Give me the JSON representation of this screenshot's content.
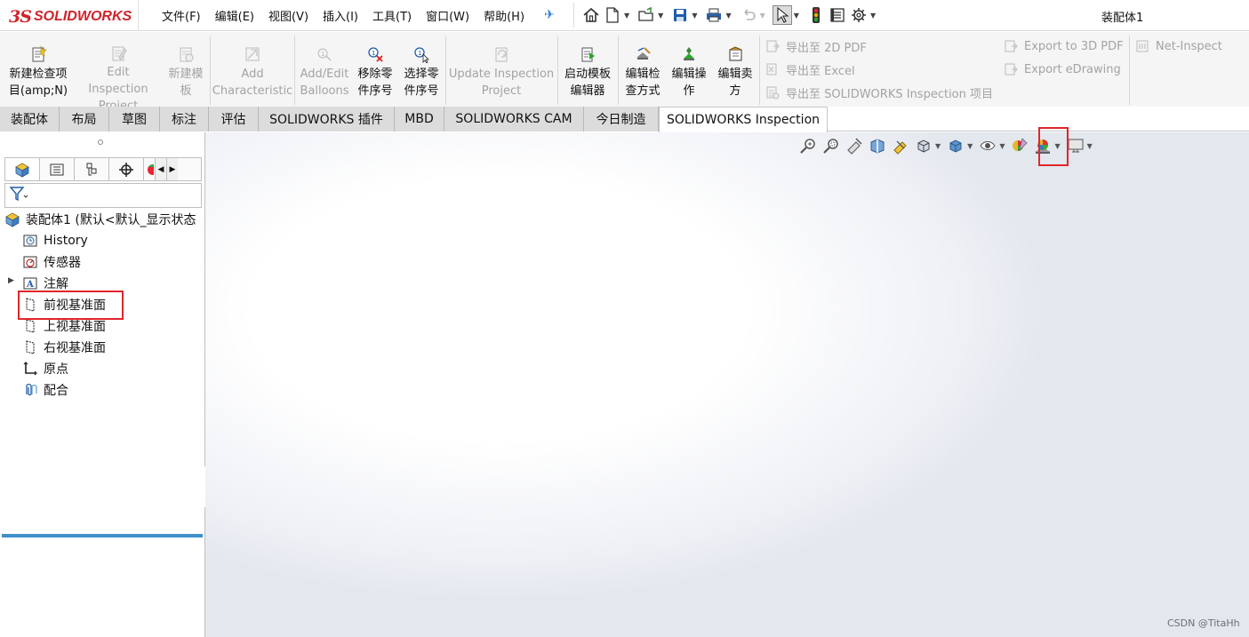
{
  "app": {
    "logo_prefix": "3S",
    "logo_text": "SOLIDWORKS",
    "document_title": "装配体1"
  },
  "menu": [
    "文件(F)",
    "编辑(E)",
    "视图(V)",
    "插入(I)",
    "工具(T)",
    "窗口(W)",
    "帮助(H)"
  ],
  "toolbar": {
    "new_inspection_project": [
      "新建检查项",
      "目(amp;N)"
    ],
    "edit_inspection_project": [
      "Edit Inspection",
      "Project"
    ],
    "new_template": [
      "新建模",
      "板"
    ],
    "add_characteristic": [
      "Add",
      "Characteristic"
    ],
    "add_edit_balloons": [
      "Add/Edit",
      "Balloons"
    ],
    "remove_part_number": [
      "移除零",
      "件序号"
    ],
    "select_part_number": [
      "选择零",
      "件序号"
    ],
    "update_inspection_project": [
      "Update Inspection",
      "Project"
    ],
    "launch_template_editor": [
      "启动模板",
      "编辑器"
    ],
    "edit_inspection_method": [
      "编辑检",
      "查方式"
    ],
    "edit_operation": [
      "编辑操",
      "作"
    ],
    "edit_vendor": [
      "编辑卖",
      "方"
    ],
    "export_2d_pdf": "导出至 2D PDF",
    "export_excel": "导出至 Excel",
    "export_sw_inspection": "导出至 SOLIDWORKS Inspection 项目",
    "export_3d_pdf": "Export to 3D PDF",
    "export_edrawing": "Export eDrawing",
    "net_inspect": "Net-Inspect"
  },
  "tabs": [
    "装配体",
    "布局",
    "草图",
    "标注",
    "评估",
    "SOLIDWORKS 插件",
    "MBD",
    "SOLIDWORKS CAM",
    "今日制造",
    "SOLIDWORKS Inspection"
  ],
  "active_tab": "SOLIDWORKS Inspection",
  "tree": {
    "root": "装配体1 (默认<默认_显示状态",
    "items": [
      "History",
      "传感器",
      "注解",
      "前视基准面",
      "上视基准面",
      "右视基准面",
      "原点",
      "配合"
    ],
    "highlighted_item": "前视基准面"
  },
  "colors": {
    "brand_red": "#d2232a",
    "highlight_box": "#e0262c",
    "tree_selection_bar": "#3d90c8",
    "tab_inactive": "#dcdcdc"
  },
  "watermark": "CSDN @TitaHh"
}
